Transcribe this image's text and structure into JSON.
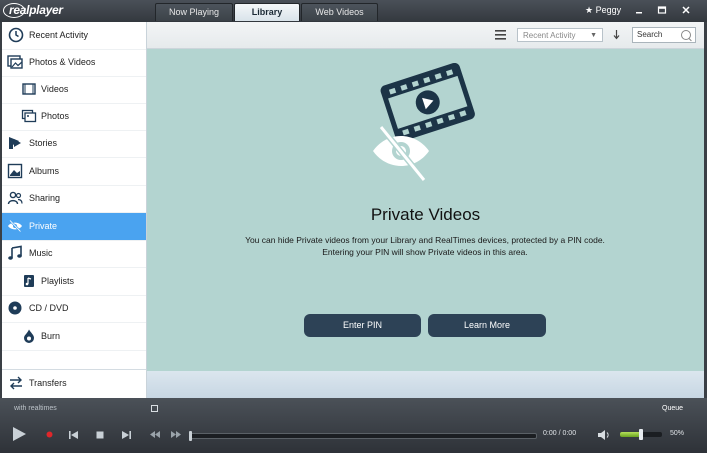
{
  "app": {
    "logo_text": "realplayer"
  },
  "tabs": [
    {
      "label": "Now Playing"
    },
    {
      "label": "Library"
    },
    {
      "label": "Web Videos"
    }
  ],
  "user": {
    "name": "★ Peggy"
  },
  "sidebar": {
    "items": [
      {
        "label": "Recent Activity",
        "icon": "clock-icon"
      },
      {
        "label": "Photos & Videos",
        "icon": "photos-videos-icon"
      },
      {
        "label": "Videos",
        "icon": "film-icon"
      },
      {
        "label": "Photos",
        "icon": "photo-icon"
      },
      {
        "label": "Stories",
        "icon": "stories-icon"
      },
      {
        "label": "Albums",
        "icon": "album-icon"
      },
      {
        "label": "Sharing",
        "icon": "people-icon"
      },
      {
        "label": "Private",
        "icon": "eye-slash-icon"
      },
      {
        "label": "Music",
        "icon": "music-note-icon"
      },
      {
        "label": "Playlists",
        "icon": "playlist-icon"
      },
      {
        "label": "CD / DVD",
        "icon": "disc-icon"
      },
      {
        "label": "Burn",
        "icon": "burn-icon"
      }
    ],
    "transfers": {
      "label": "Transfers",
      "icon": "transfer-arrows-icon"
    }
  },
  "toolbar": {
    "sort_value": "Recent Activity",
    "search_placeholder": "Search"
  },
  "main": {
    "title": "Private Videos",
    "description": "You can hide Private videos from your Library and RealTimes devices, protected by a PIN code. Entering your PIN will show Private videos in this area.",
    "enter_pin_label": "Enter PIN",
    "learn_more_label": "Learn More"
  },
  "player": {
    "with_realtimes": "with realtimes",
    "queue_label": "Queue",
    "time": "0:00 / 0:00",
    "volume_text": "50%",
    "volume_fraction": 0.5
  },
  "colors": {
    "content_bg": "#b3d4d0",
    "selected_item": "#4aa3f0",
    "button_bg": "#2d4256",
    "volume_fill": "#8cc63f"
  }
}
